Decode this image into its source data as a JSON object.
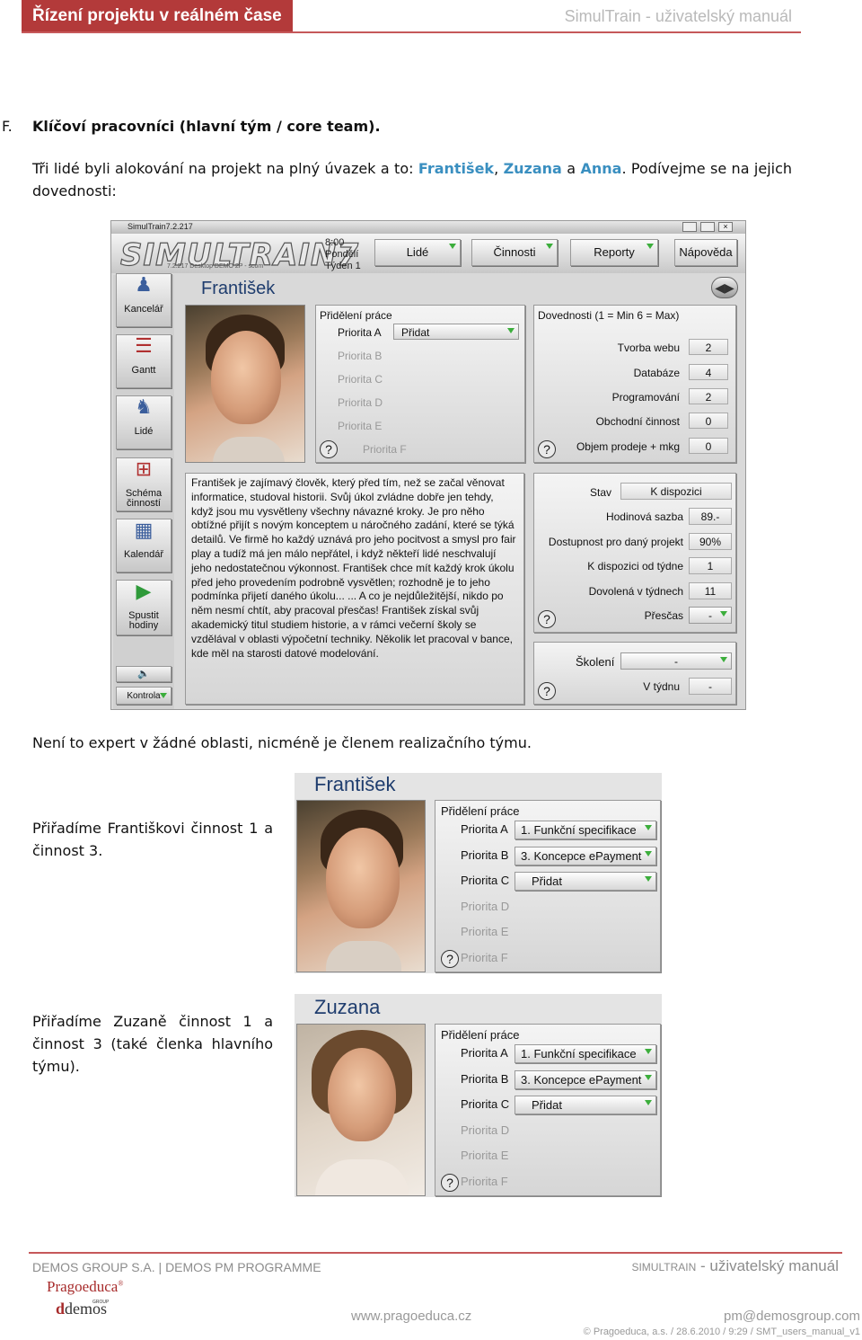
{
  "header": {
    "left_title": "Řízení projektu v reálném čase",
    "right_title": "SimulTrain - uživatelský manuál"
  },
  "section": {
    "letter": "F.",
    "heading": "Klíčoví pracovníci (hlavní tým / core team).",
    "intro_1": "Tři lidé byli alokování na projekt na plný úvazek a to: ",
    "name_1": "František",
    "sep_1": ", ",
    "name_2": "Zuzana",
    "sep_2": " a ",
    "name_3": "Anna",
    "intro_2": ". Podívejme se na jejich dovednosti:"
  },
  "app": {
    "window_title": "SimulTrain7.2.217",
    "logo": "SIMULTRAIN7",
    "logo_sub": "7.2.217 Desktop DEMO 2P - scom",
    "time": "8:00",
    "day": "Pondělí",
    "week": "Týden 1",
    "menu": [
      "Lidé",
      "Činnosti",
      "Reporty",
      "Nápověda"
    ],
    "sidebar": [
      "Kancelář",
      "Gantt",
      "Lidé",
      "Schéma činností",
      "Kalendář",
      "Spustit hodiny"
    ],
    "kontrola": "Kontrola",
    "person_name": "František",
    "assignment": {
      "title": "Přidělení práce",
      "priorities": [
        "Priorita A",
        "Priorita B",
        "Priorita C",
        "Priorita D",
        "Priorita E",
        "Priorita F"
      ],
      "dropdown_a": "Přidat"
    },
    "skills": {
      "title": "Dovednosti (1 = Min   6 = Max)",
      "rows": [
        {
          "label": "Tvorba webu",
          "value": "2"
        },
        {
          "label": "Databáze",
          "value": "4"
        },
        {
          "label": "Programování",
          "value": "2"
        },
        {
          "label": "Obchodní činnost",
          "value": "0"
        },
        {
          "label": "Objem prodeje + mkg",
          "value": "0"
        }
      ]
    },
    "bio": "František je zajímavý člověk, který před tím, než se začal věnovat informatice, studoval historii. Svůj úkol zvládne dobře jen tehdy, když jsou mu vysvětleny všechny návazné kroky. Je pro něho obtížné přijít s novým konceptem u náročného zadání, které se týká detailů. Ve firmě ho každý uznává pro jeho pocitvost a smysl pro fair play a tudíž má jen málo nepřátel, i když někteří lidé neschvalují jeho nedostatečnou výkonnost. František chce mít každý krok úkolu před jeho provedením podrobně vysvětlen; rozhodně je to jeho podmínka přijetí daného úkolu... ... A co je nejdůležitější, nikdo po něm nesmí chtít, aby pracoval přesčas! František získal svůj akademický titul studiem historie, a v rámci večerní školy se vzdělával v oblasti výpočetní techniky. Několik let pracoval v bance, kde měl na starosti datové modelování.",
    "status": {
      "rows": [
        {
          "label": "Stav",
          "value": "K dispozici"
        },
        {
          "label": "Hodinová sazba",
          "value": "89.-"
        },
        {
          "label": "Dostupnost pro daný projekt",
          "value": "90%"
        },
        {
          "label": "K dispozici od týdne",
          "value": "1"
        },
        {
          "label": "Dovolená v týdnech",
          "value": "11"
        },
        {
          "label": "Přesčas",
          "value": "-"
        }
      ]
    },
    "training": {
      "label": "Školení",
      "value": "-",
      "week_label": "V týdnu",
      "week_value": "-"
    }
  },
  "after_text": "Není to expert v žádné oblasti, nicméně je členem realizačního týmu.",
  "block_1": {
    "text": "Přiřadíme Františkovi činnost 1 a činnost 3.",
    "name": "František",
    "title": "Přidělení práce",
    "priorities": [
      "Priorita A",
      "Priorita B",
      "Priorita C",
      "Priorita D",
      "Priorita E",
      "Priorita F"
    ],
    "values": [
      "1. Funkční specifikace",
      "3. Koncepce ePayment",
      "Přidat"
    ]
  },
  "block_2": {
    "text": "Přiřadíme Zuzaně činnost 1 a činnost 3 (také členka hlavního týmu).",
    "name": "Zuzana",
    "title": "Přidělení práce",
    "priorities": [
      "Priorita A",
      "Priorita B",
      "Priorita C",
      "Priorita D",
      "Priorita E",
      "Priorita F"
    ],
    "values": [
      "1. Funkční specifikace",
      "3. Koncepce ePayment",
      "Přidat"
    ]
  },
  "footer": {
    "left": "DEMOS GROUP S.A. | DEMOS PM PROGRAMME",
    "right_a": "SIMULTRAIN",
    "right_b": " - uživatelský manuál",
    "logo_1": "Pragoeduca",
    "logo_2": "demos",
    "logo_2_letter": "d",
    "logo_group": "GROUP",
    "url": "www.pragoeduca.cz",
    "mail": "pm@demosgroup.com",
    "copyright": "© Pragoeduca, a.s. / 28.6.2010 / 9:29 / SMT_users_manual_v1"
  },
  "colors": {
    "accent_red": "#b33a3a",
    "name_blue": "#3a8fc0",
    "app_title_blue": "#1f3d6e"
  }
}
